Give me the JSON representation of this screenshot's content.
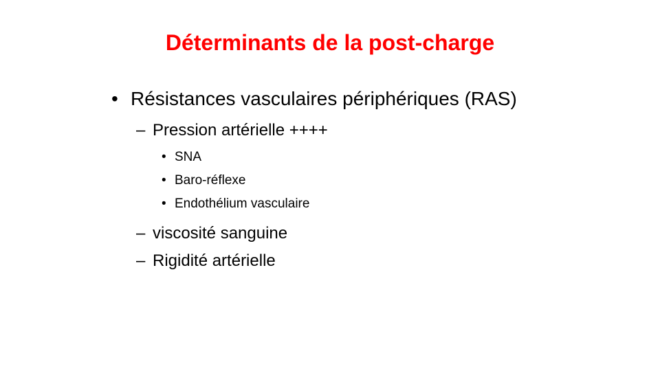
{
  "slide": {
    "title": "Déterminants de la post-charge",
    "title_color": "#ff0000",
    "bullet_l1": "•",
    "bullet_l2": "–",
    "bullet_l3": "•",
    "items": [
      {
        "text": "Résistances vasculaires périphériques (RAS)"
      }
    ],
    "subitems": [
      {
        "text": "Pression artérielle ++++"
      },
      {
        "text": "viscosité sanguine"
      },
      {
        "text": "Rigidité artérielle"
      }
    ],
    "subsubitems": [
      {
        "text": "SNA"
      },
      {
        "text": "Baro-réflexe"
      },
      {
        "text": "Endothélium vasculaire"
      }
    ]
  }
}
